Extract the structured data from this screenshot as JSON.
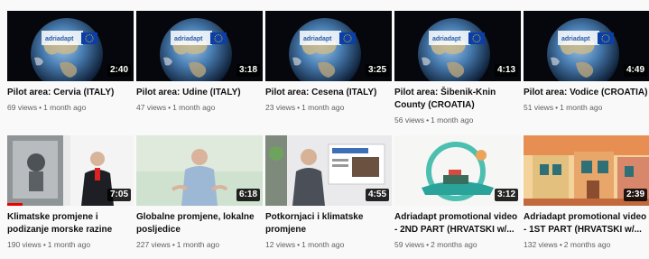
{
  "colors": {
    "progress": "#ee0000",
    "title": "#0f0f0f",
    "meta": "#606060"
  },
  "rows": [
    [
      {
        "title": "Pilot area: Cervia (ITALY)",
        "views": "69 views",
        "ago": "1 month ago",
        "duration": "2:40",
        "progress_pct": 0,
        "thumb": "globe-eu"
      },
      {
        "title": "Pilot area: Udine (ITALY)",
        "views": "47 views",
        "ago": "1 month ago",
        "duration": "3:18",
        "progress_pct": 0,
        "thumb": "globe-eu"
      },
      {
        "title": "Pilot area: Cesena (ITALY)",
        "views": "23 views",
        "ago": "1 month ago",
        "duration": "3:25",
        "progress_pct": 0,
        "thumb": "globe-eu"
      },
      {
        "title": "Pilot area: Šibenik-Knin County (CROATIA)",
        "views": "56 views",
        "ago": "1 month ago",
        "duration": "4:13",
        "progress_pct": 0,
        "thumb": "globe-eu"
      },
      {
        "title": "Pilot area: Vodice (CROATIA)",
        "views": "51 views",
        "ago": "1 month ago",
        "duration": "4:49",
        "progress_pct": 0,
        "thumb": "globe-eu"
      }
    ],
    [
      {
        "title": "Klimatske promjene i podizanje morske razine",
        "views": "190 views",
        "ago": "1 month ago",
        "duration": "7:05",
        "progress_pct": 12,
        "thumb": "speaker-studio"
      },
      {
        "title": "Globalne promjene, lokalne posljedice",
        "views": "227 views",
        "ago": "1 month ago",
        "duration": "6:18",
        "progress_pct": 0,
        "thumb": "speaker-green"
      },
      {
        "title": "Potkornjaci i klimatske promjene",
        "views": "12 views",
        "ago": "1 month ago",
        "duration": "4:55",
        "progress_pct": 0,
        "thumb": "speaker-screen"
      },
      {
        "title": "Adriadapt promotional video - 2ND PART (HRVATSKI w/...",
        "views": "59 views",
        "ago": "2 months ago",
        "duration": "3:12",
        "progress_pct": 0,
        "thumb": "cartoon-boat"
      },
      {
        "title": "Adriadapt promotional video - 1ST PART (HRVATSKI w/...",
        "views": "132 views",
        "ago": "2 months ago",
        "duration": "2:39",
        "progress_pct": 0,
        "thumb": "cartoon-town"
      }
    ]
  ]
}
